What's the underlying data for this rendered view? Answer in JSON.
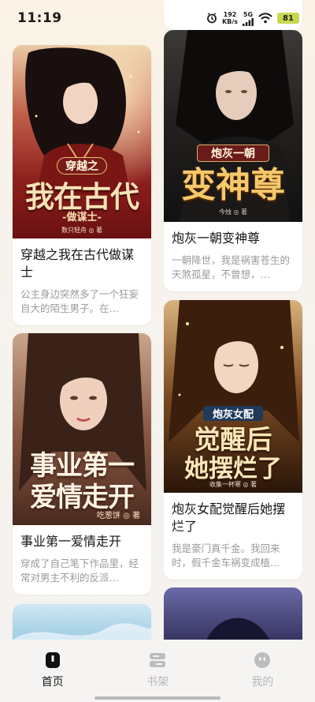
{
  "status_bar": {
    "time": "11:19",
    "speed_value": "192",
    "speed_unit": "KB/s",
    "network": "5G",
    "battery": "81"
  },
  "books": [
    {
      "title": "穿越之我在古代做谋士",
      "description": "公主身边突然多了一个狂妄自大的陌生男子。在…",
      "cover_small": "穿越之",
      "cover_main": "我在古代",
      "cover_sub": "-做谋士-",
      "cover_author": "数只轻舟 ◎ 著"
    },
    {
      "title": "炮灰一朝变神尊",
      "description": "一朝降世，我是祸害苍生的天煞孤星，不曾想，…",
      "cover_small": "炮灰一朝",
      "cover_main": "变神尊",
      "cover_author": "今烛 ◎ 著"
    },
    {
      "title": "事业第一爱情走开",
      "description": "穿成了自己笔下作品里，经常对男主不利的反派…",
      "cover_main_line1": "事业第一",
      "cover_main_line2": "爱情走开",
      "cover_author": "吃葱饼 ◎ 著"
    },
    {
      "title": "炮灰女配觉醒后她摆烂了",
      "description": "我是豪门真千金。我回来时，假千金车祸变成植…",
      "cover_small": "炮灰女配",
      "cover_main_line1": "觉醒后",
      "cover_main_line2": "她摆烂了",
      "cover_author": "收集一杯寒 ◎ 著"
    }
  ],
  "tabs": [
    {
      "label": "首页",
      "icon": "book-icon",
      "active": true
    },
    {
      "label": "书架",
      "icon": "bookshelf-icon",
      "active": false
    },
    {
      "label": "我的",
      "icon": "profile-face-icon",
      "active": false
    }
  ],
  "colors": {
    "active_tab": "#1b1b1b",
    "inactive_tab": "#b8b8b8",
    "card_bg": "#ffffff",
    "battery": "#c7d84e"
  }
}
